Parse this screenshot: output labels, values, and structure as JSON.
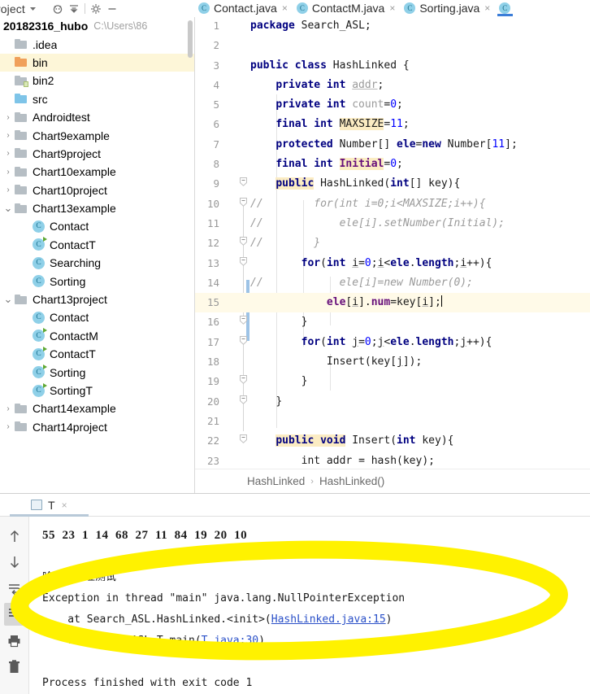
{
  "project_toolbar": {
    "title": "roject",
    "icons": [
      "chevron-down-icon",
      "locate-icon",
      "collapse-all-icon",
      "settings-gear-icon",
      "minimize-icon"
    ]
  },
  "editor_tabs": [
    {
      "label": "Contact.java",
      "icon": "java-class-icon",
      "close": "×",
      "active": false
    },
    {
      "label": "ContactM.java",
      "icon": "java-class-icon",
      "close": "×",
      "active": false
    },
    {
      "label": "Sorting.java",
      "icon": "java-class-icon",
      "close": "×",
      "active": false
    },
    {
      "label": "",
      "icon": "java-class-icon",
      "close": "",
      "active": true
    }
  ],
  "project_tree": {
    "root": {
      "name": "20182316_hubo",
      "path": "C:\\Users\\86"
    },
    "items": [
      {
        "label": ".idea",
        "indent": 1,
        "arrow": "",
        "icon": "folder-gray",
        "selected": false
      },
      {
        "label": "bin",
        "indent": 1,
        "arrow": "",
        "icon": "folder-orange",
        "selected": true
      },
      {
        "label": "bin2",
        "indent": 1,
        "arrow": "",
        "icon": "folder-module",
        "selected": false
      },
      {
        "label": "src",
        "indent": 1,
        "arrow": "",
        "icon": "folder-blue",
        "selected": false
      },
      {
        "label": "Androidtest",
        "indent": 1,
        "arrow": "›",
        "icon": "folder-gray",
        "selected": false
      },
      {
        "label": "Chart9example",
        "indent": 1,
        "arrow": "›",
        "icon": "folder-gray",
        "selected": false
      },
      {
        "label": "Chart9project",
        "indent": 1,
        "arrow": "›",
        "icon": "folder-gray",
        "selected": false
      },
      {
        "label": "Chart10example",
        "indent": 1,
        "arrow": "›",
        "icon": "folder-gray",
        "selected": false
      },
      {
        "label": "Chart10project",
        "indent": 1,
        "arrow": "›",
        "icon": "folder-gray",
        "selected": false
      },
      {
        "label": "Chart13example",
        "indent": 1,
        "arrow": "⌄",
        "icon": "folder-gray",
        "selected": false
      },
      {
        "label": "Contact",
        "indent": 2,
        "arrow": "",
        "icon": "class",
        "selected": false
      },
      {
        "label": "ContactT",
        "indent": 2,
        "arrow": "",
        "icon": "class-run",
        "selected": false
      },
      {
        "label": "Searching",
        "indent": 2,
        "arrow": "",
        "icon": "class",
        "selected": false
      },
      {
        "label": "Sorting",
        "indent": 2,
        "arrow": "",
        "icon": "class",
        "selected": false
      },
      {
        "label": "Chart13project",
        "indent": 1,
        "arrow": "⌄",
        "icon": "folder-gray",
        "selected": false
      },
      {
        "label": "Contact",
        "indent": 2,
        "arrow": "",
        "icon": "class",
        "selected": false
      },
      {
        "label": "ContactM",
        "indent": 2,
        "arrow": "",
        "icon": "class-run",
        "selected": false
      },
      {
        "label": "ContactT",
        "indent": 2,
        "arrow": "",
        "icon": "class-run",
        "selected": false
      },
      {
        "label": "Sorting",
        "indent": 2,
        "arrow": "",
        "icon": "class-run",
        "selected": false
      },
      {
        "label": "SortingT",
        "indent": 2,
        "arrow": "",
        "icon": "class-run",
        "selected": false
      },
      {
        "label": "Chart14example",
        "indent": 1,
        "arrow": "›",
        "icon": "folder-gray",
        "selected": false
      },
      {
        "label": "Chart14project",
        "indent": 1,
        "arrow": "›",
        "icon": "folder-gray",
        "selected": false
      }
    ]
  },
  "code": {
    "language": "java",
    "current_line": 15,
    "lines": [
      {
        "n": "1",
        "fold": "",
        "html": "<span class=\"kw\">package</span> <span class=\"plain\">Search_ASL;</span>"
      },
      {
        "n": "2",
        "fold": "",
        "html": ""
      },
      {
        "n": "3",
        "fold": "",
        "html": "<span class=\"kw\">public class</span> <span class=\"plain\">HashLinked {</span>"
      },
      {
        "n": "4",
        "fold": "",
        "html": "    <span class=\"kw\">private int</span> <span class=\"gray udl\">addr</span><span class=\"plain\">;</span>"
      },
      {
        "n": "5",
        "fold": "",
        "html": "    <span class=\"kw\">private int</span> <span class=\"gray\">count</span><span class=\"plain\">=</span><span class=\"num\">0</span><span class=\"plain\">;</span>"
      },
      {
        "n": "6",
        "fold": "",
        "html": "    <span class=\"kw\">final int</span> <span class=\"hl plain\">MAXSIZE</span><span class=\"plain\">=</span><span class=\"num\">11</span><span class=\"plain\">;</span>"
      },
      {
        "n": "7",
        "fold": "",
        "html": "    <span class=\"kw\">protected</span> <span class=\"plain\">Number[] </span><span class=\"kw\">ele</span><span class=\"plain\">=</span><span class=\"kw\">new</span> <span class=\"plain\">Number[</span><span class=\"num\">11</span><span class=\"plain\">];</span>"
      },
      {
        "n": "8",
        "fold": "",
        "html": "    <span class=\"kw\">final int</span> <span class=\"hl fld\">Initial</span><span class=\"plain\">=</span><span class=\"num\">0</span><span class=\"plain\">;</span>"
      },
      {
        "n": "9",
        "fold": "⌄",
        "html": "    <span class=\"hl kw\">public</span> <span class=\"plain\">HashLinked(</span><span class=\"kw\">int</span><span class=\"plain\">[] key){</span>"
      },
      {
        "n": "10",
        "fold": "⌄",
        "html": "<span class=\"cmt\">//        for(int i=0;i&lt;MAXSIZE;i++){</span>"
      },
      {
        "n": "11",
        "fold": "",
        "html": "<span class=\"cmt\">//            ele[i].setNumber(Initial);</span>"
      },
      {
        "n": "12",
        "fold": "⌄",
        "html": "<span class=\"cmt\">//        }</span>"
      },
      {
        "n": "13",
        "fold": "⌄",
        "html": "        <span class=\"kw\">for</span><span class=\"plain\">(</span><span class=\"kw\">int</span> <span class=\"udl plain\">i</span><span class=\"plain\">=</span><span class=\"num\">0</span><span class=\"plain\">;</span><span class=\"udl plain\">i</span><span class=\"plain\">&lt;</span><span class=\"kw\">ele</span><span class=\"plain\">.</span><span class=\"kw\">length</span><span class=\"plain\">;</span><span class=\"udl plain\">i</span><span class=\"plain\">++){</span>"
      },
      {
        "n": "14",
        "fold": "",
        "html": "<span class=\"cmt\">//            ele[i]=new Number(0);</span>"
      },
      {
        "n": "15",
        "fold": "",
        "html": "            <span class=\"fld\">ele</span><span class=\"plain\">[</span><span class=\"udl plain\">i</span><span class=\"plain\">].</span><span class=\"fld\">num</span><span class=\"plain\">=key[</span><span class=\"udl plain\">i</span><span class=\"plain\">];</span><span class=\"caret\"></span>"
      },
      {
        "n": "16",
        "fold": "⌄",
        "html": "        <span class=\"plain\">}</span>"
      },
      {
        "n": "17",
        "fold": "⌄",
        "html": "        <span class=\"kw\">for</span><span class=\"plain\">(</span><span class=\"kw\">int</span> <span class=\"udl plain\">j</span><span class=\"plain\">=</span><span class=\"num\">0</span><span class=\"plain\">;</span><span class=\"udl plain\">j</span><span class=\"plain\">&lt;</span><span class=\"kw\">ele</span><span class=\"plain\">.</span><span class=\"kw\">length</span><span class=\"plain\">;</span><span class=\"udl plain\">j</span><span class=\"plain\">++){</span>"
      },
      {
        "n": "18",
        "fold": "",
        "html": "            <span class=\"plain\">Insert(key[</span><span class=\"udl plain\">j</span><span class=\"plain\">]);</span>"
      },
      {
        "n": "19",
        "fold": "⌄",
        "html": "        <span class=\"plain\">}</span>"
      },
      {
        "n": "20",
        "fold": "⌄",
        "html": "    <span class=\"plain\">}</span>"
      },
      {
        "n": "21",
        "fold": "",
        "html": ""
      },
      {
        "n": "22",
        "fold": "⌄",
        "html": "    <span class=\"hl kw\">public void</span> <span class=\"plain\">Insert(</span><span class=\"kw\">int</span> <span class=\"plain\">key){</span>"
      },
      {
        "n": "23",
        "fold": "",
        "html": "        <span class=\"plain\">int addr = hash(key);</span>"
      }
    ]
  },
  "breadcrumb": {
    "class": "HashLinked",
    "separator": "›",
    "method": "HashLinked()"
  },
  "console": {
    "tab": {
      "label": "T",
      "icon": "console-icon",
      "close": "×"
    },
    "sidebar_buttons": [
      {
        "name": "scroll-up-icon",
        "glyph": "↑",
        "active": false
      },
      {
        "name": "scroll-down-icon",
        "glyph": "↓",
        "active": false
      },
      {
        "name": "soft-wrap-icon",
        "glyph": "↵",
        "active": false
      },
      {
        "name": "scroll-to-end-icon",
        "glyph": "⇩",
        "active": true
      },
      {
        "name": "print-icon",
        "glyph": "⎙",
        "active": false
      },
      {
        "name": "clear-all-icon",
        "glyph": "Ὕ1",
        "active": false
      }
    ],
    "output": [
      {
        "text": "55  23  1  14  68  27  11  84  19  20  10",
        "style": "nums"
      },
      {
        "text": "",
        "style": "plain"
      },
      {
        "text": "哈希链地址测试",
        "style": "cjk"
      },
      {
        "text": "Exception in thread \"main\" java.lang.NullPointerException",
        "style": "plain"
      },
      {
        "text": "    at Search_ASL.HashLinked.<init>(",
        "link": "HashLinked.java:15",
        "tail": ")",
        "style": "plain-link"
      },
      {
        "text": "    at Search_ASL.T.main(",
        "link": "T.java:30",
        "tail": ")",
        "style": "plain-link"
      },
      {
        "text": "",
        "style": "plain"
      },
      {
        "text": "Process finished with exit code 1",
        "style": "plain"
      }
    ]
  },
  "annotation": {
    "type": "yellow-highlighter-ellipse",
    "color": "#fff200"
  }
}
